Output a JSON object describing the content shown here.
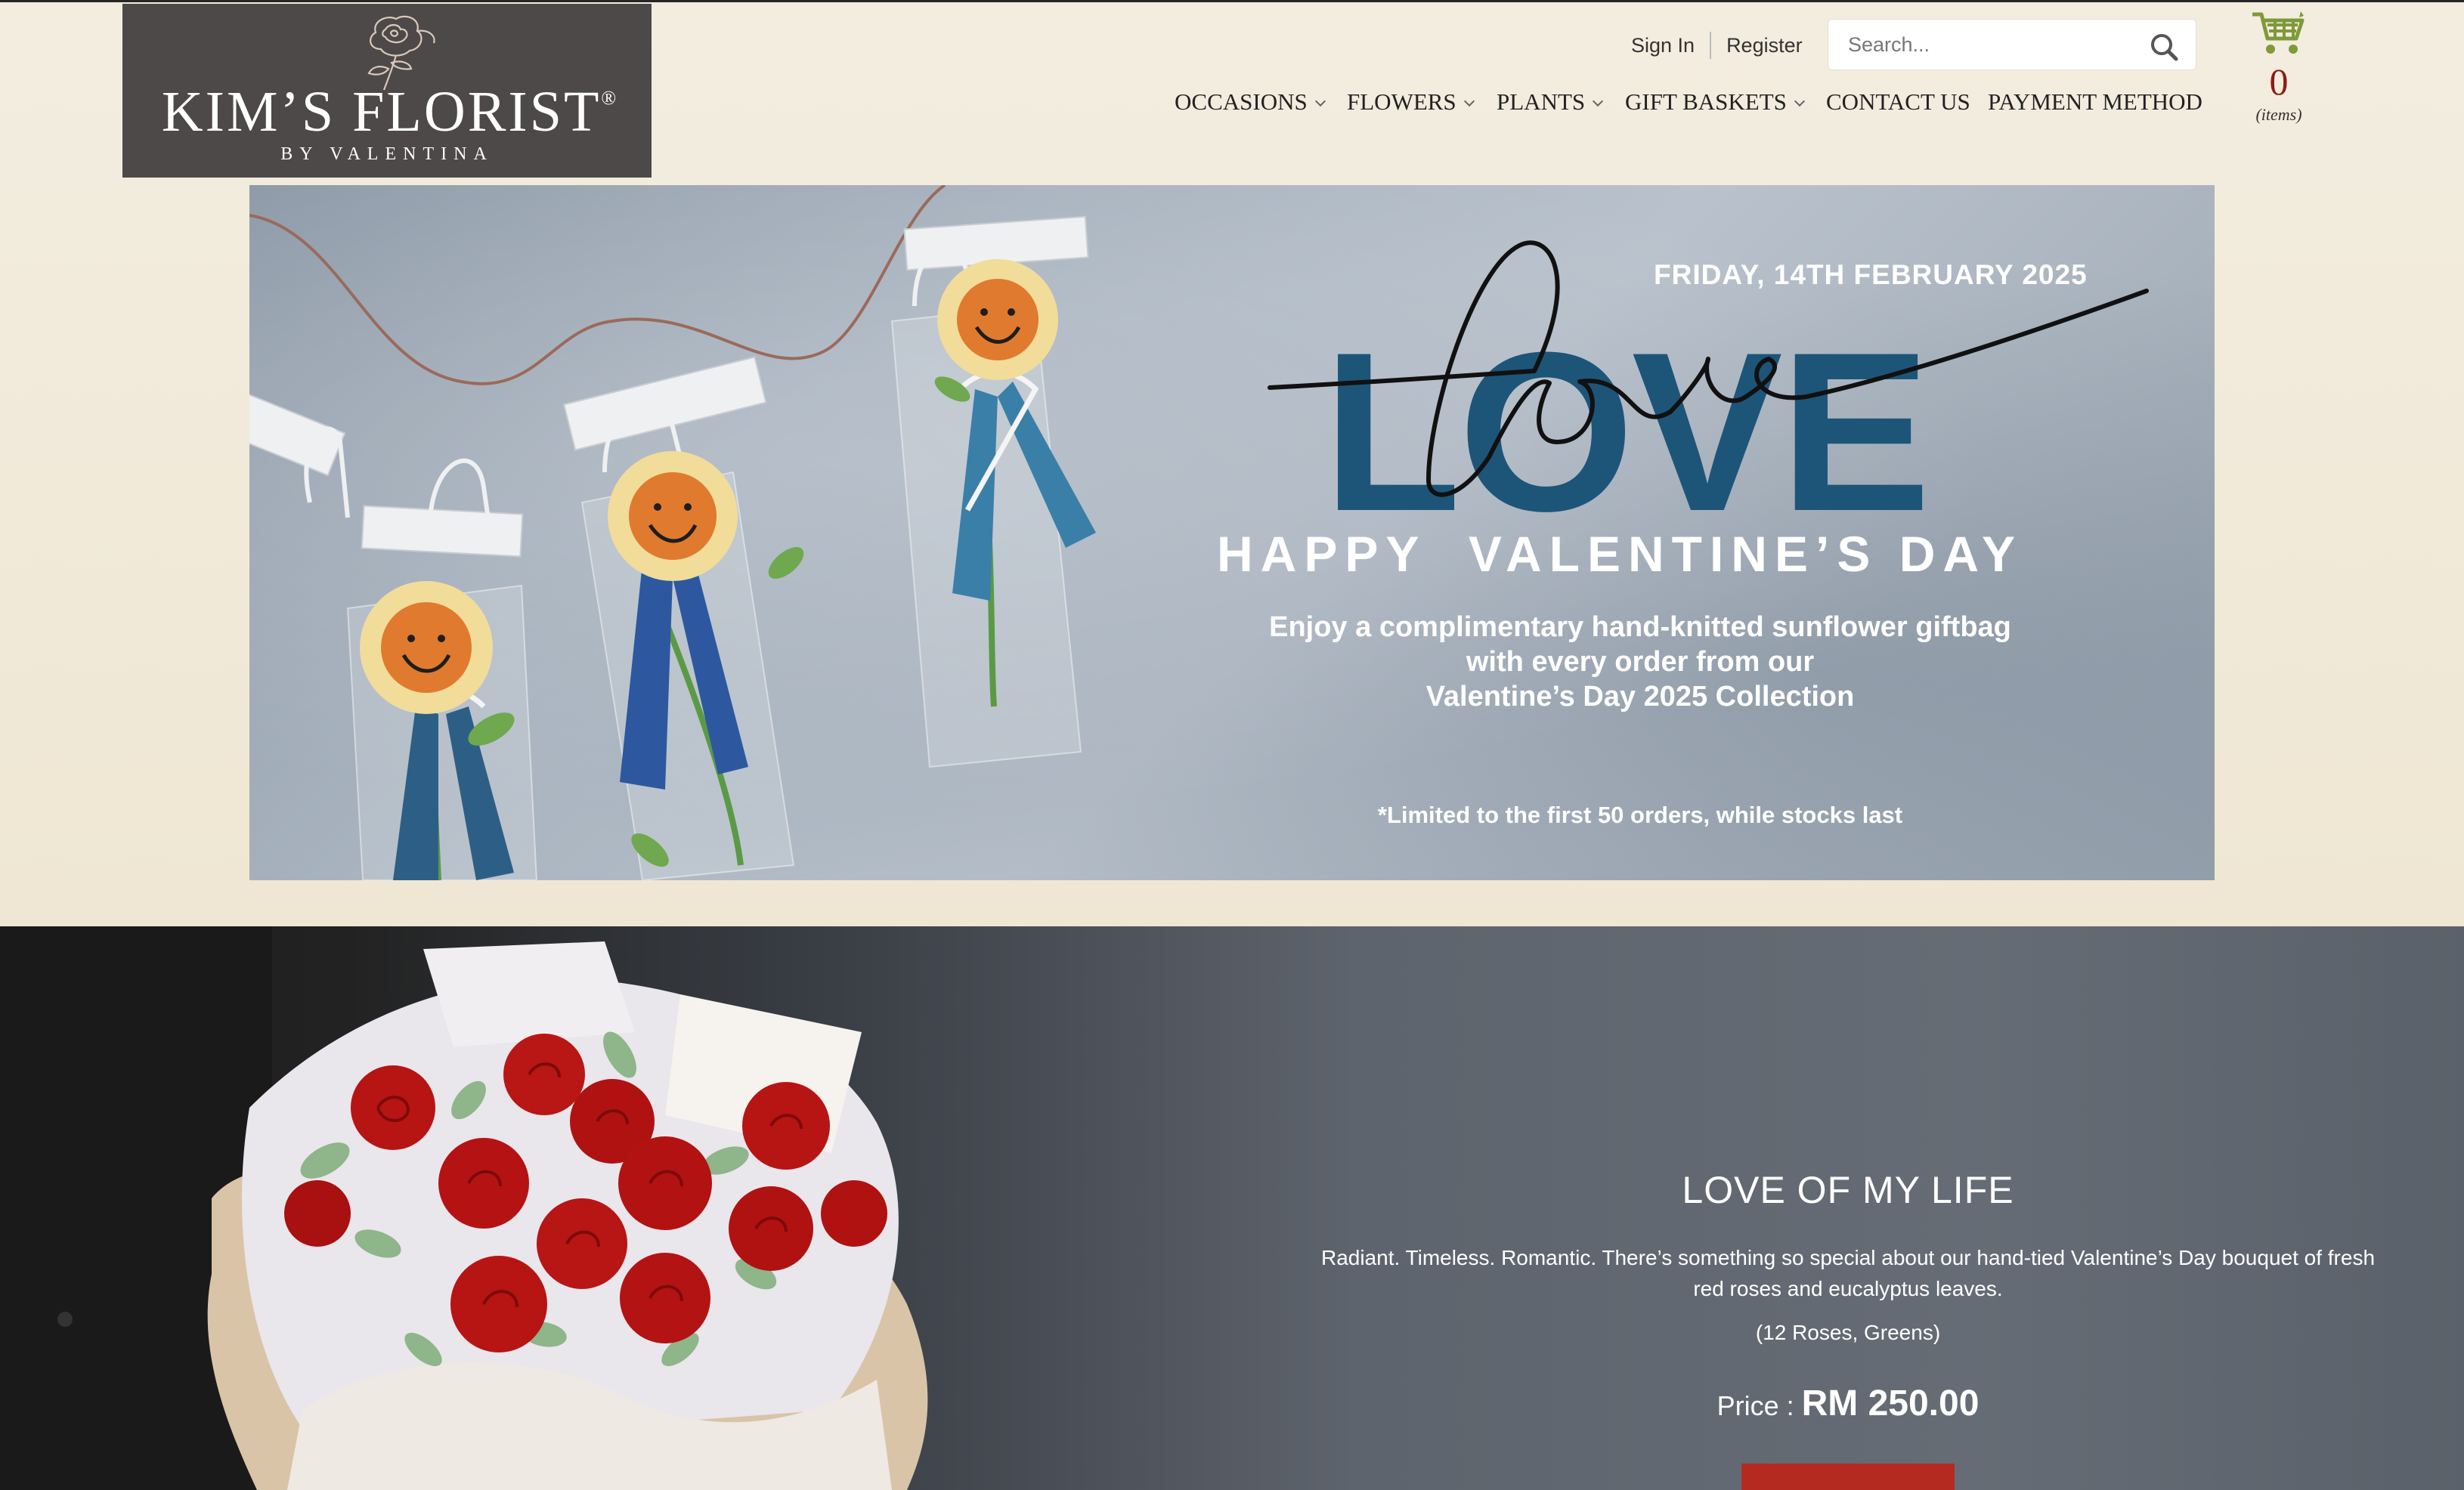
{
  "header": {
    "logo": {
      "name": "KIM’S FLORIST",
      "registered": "®",
      "tagline": "BY VALENTINA"
    },
    "auth": {
      "sign_in": "Sign In",
      "register": "Register"
    },
    "search": {
      "placeholder": "Search..."
    },
    "cart": {
      "count": "0",
      "items_label": "(items)"
    },
    "nav": [
      {
        "label": "OCCASIONS",
        "has_dropdown": true
      },
      {
        "label": "FLOWERS",
        "has_dropdown": true
      },
      {
        "label": "PLANTS",
        "has_dropdown": true
      },
      {
        "label": "GIFT BASKETS",
        "has_dropdown": true
      },
      {
        "label": "CONTACT US",
        "has_dropdown": false
      },
      {
        "label": "PAYMENT METHOD",
        "has_dropdown": false
      }
    ]
  },
  "banner": {
    "date": "FRIDAY, 14TH FEBRUARY 2025",
    "headline": "LOVE",
    "script_word": "love",
    "greeting": "HAPPY  VALENTINE’S DAY",
    "offer_line1": "Enjoy a complimentary hand-knitted sunflower giftbag",
    "offer_line2": "with every order from our",
    "offer_line3": "Valentine’s Day 2025 Collection",
    "limit": "*Limited to the first 50 orders, while stocks last"
  },
  "product": {
    "title": "LOVE OF MY LIFE",
    "description": "Radiant. Timeless. Romantic. There’s something so special about our hand-tied Valentine’s Day bouquet of fresh red roses and eucalyptus leaves.",
    "contents": "(12 Roses, Greens)",
    "price_label": "Price : ",
    "price": "RM 250.00"
  },
  "colors": {
    "header_bg": "#f1ebd9",
    "logo_bg": "#4d4948",
    "love_blue": "#1d5579",
    "cart_count": "#8b1d16",
    "cart_icon": "#7f9a3a",
    "button_red": "#b42a21"
  },
  "icons": [
    "rose-logo-icon",
    "search-icon",
    "shopping-cart-icon",
    "chevron-down-icon"
  ]
}
